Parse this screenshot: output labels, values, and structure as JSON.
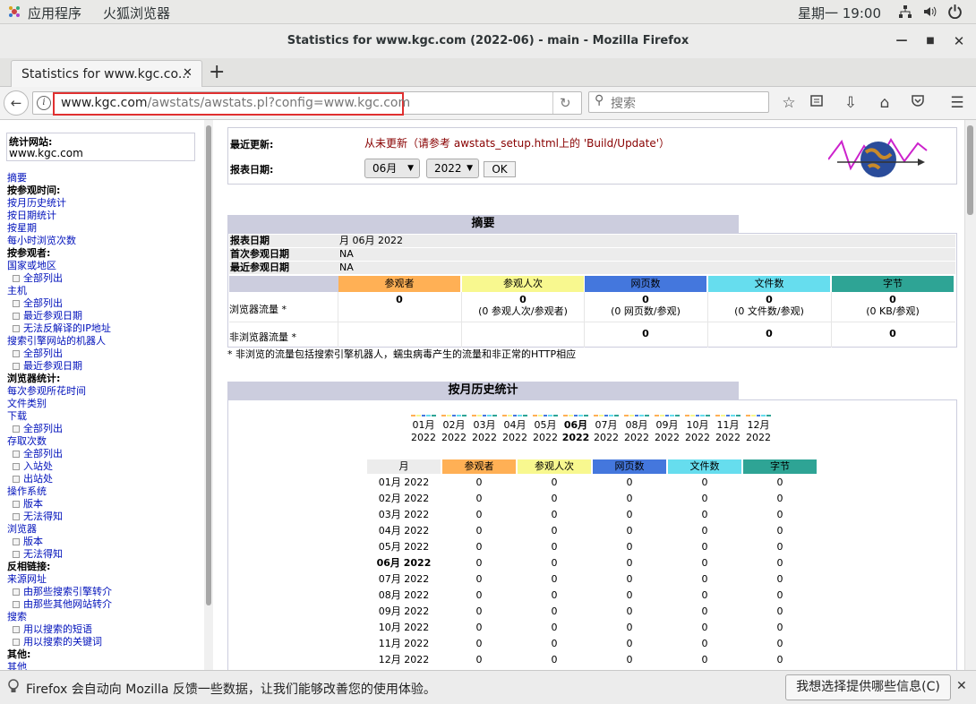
{
  "topbar": {
    "apps": "应用程序",
    "browser": "火狐浏览器",
    "clock": "星期一 19:00"
  },
  "window": {
    "title": "Statistics for www.kgc.com (2022-06) - main - Mozilla Firefox"
  },
  "tab": {
    "label": "Statistics for www.kgc.co..."
  },
  "nav": {
    "url_domain": "www.kgc.com",
    "url_path": "/awstats/awstats.pl?config=www.kgc.com",
    "search_placeholder": "搜索",
    "highlight_color": "#e03030"
  },
  "sidebar": {
    "site_label": "统计网站:",
    "site_value": "www.kgc.com",
    "items": [
      {
        "t": "摘要",
        "k": "link"
      },
      {
        "t": "按参观时间:",
        "k": "head"
      },
      {
        "t": "按月历史统计",
        "k": "link"
      },
      {
        "t": "按日期统计",
        "k": "link"
      },
      {
        "t": "按星期",
        "k": "link"
      },
      {
        "t": "每小时浏览次数",
        "k": "link"
      },
      {
        "t": "按参观者:",
        "k": "head"
      },
      {
        "t": "国家或地区",
        "k": "link"
      },
      {
        "t": "全部列出",
        "k": "sub"
      },
      {
        "t": "主机",
        "k": "link"
      },
      {
        "t": "全部列出",
        "k": "sub"
      },
      {
        "t": "最近参观日期",
        "k": "sub"
      },
      {
        "t": "无法反解译的IP地址",
        "k": "sub"
      },
      {
        "t": "搜索引擎网站的机器人",
        "k": "link"
      },
      {
        "t": "全部列出",
        "k": "sub"
      },
      {
        "t": "最近参观日期",
        "k": "sub"
      },
      {
        "t": "浏览器统计:",
        "k": "head"
      },
      {
        "t": "每次参观所花时间",
        "k": "link"
      },
      {
        "t": "文件类别",
        "k": "link"
      },
      {
        "t": "下载",
        "k": "link"
      },
      {
        "t": "全部列出",
        "k": "sub"
      },
      {
        "t": "存取次数",
        "k": "link"
      },
      {
        "t": "全部列出",
        "k": "sub"
      },
      {
        "t": "入站处",
        "k": "sub"
      },
      {
        "t": "出站处",
        "k": "sub"
      },
      {
        "t": "操作系统",
        "k": "link"
      },
      {
        "t": "版本",
        "k": "sub"
      },
      {
        "t": "无法得知",
        "k": "sub"
      },
      {
        "t": "浏览器",
        "k": "link"
      },
      {
        "t": "版本",
        "k": "sub"
      },
      {
        "t": "无法得知",
        "k": "sub"
      },
      {
        "t": "反相链接:",
        "k": "head"
      },
      {
        "t": "来源网址",
        "k": "link"
      },
      {
        "t": "由那些搜索引擎转介",
        "k": "sub"
      },
      {
        "t": "由那些其他网站转介",
        "k": "sub"
      },
      {
        "t": "搜索",
        "k": "link"
      },
      {
        "t": "用以搜索的短语",
        "k": "sub"
      },
      {
        "t": "用以搜索的关键词",
        "k": "sub"
      },
      {
        "t": "其他:",
        "k": "head"
      },
      {
        "t": "其他",
        "k": "link"
      }
    ]
  },
  "update_box": {
    "last_update_label": "最近更新:",
    "last_update_text": "从未更新（请参考",
    "last_update_link": "awstats_setup.html",
    "last_update_tail": "上的 'Build/Update'）",
    "report_date_label": "报表日期:",
    "month_value": "06月",
    "year_value": "2022",
    "ok_label": "OK"
  },
  "summary": {
    "title": "摘要",
    "rows": [
      {
        "label": "报表日期",
        "value": "月 06月 2022"
      },
      {
        "label": "首次参观日期",
        "value": "NA"
      },
      {
        "label": "最近参观日期",
        "value": "NA"
      }
    ],
    "headers": [
      "参观者",
      "参观人次",
      "网页数",
      "文件数",
      "字节"
    ],
    "header_colors": [
      "#ffb055",
      "#f8f88f",
      "#4477dd",
      "#66ddee",
      "#2ea495"
    ],
    "browser_label": "浏览器流量 *",
    "browser_values": [
      "0",
      "0",
      "0",
      "0",
      "0"
    ],
    "browser_subs": [
      "",
      "(0 参观人次/参观者)",
      "(0 网页数/参观)",
      "(0 文件数/参观)",
      "(0 KB/参观)"
    ],
    "nonbrowser_label": "非浏览器流量 *",
    "nonbrowser_values": [
      "",
      "",
      "0",
      "0",
      "0"
    ],
    "footnote": "* 非浏览的流量包括搜索引擎机器人，蠕虫病毒产生的流量和非正常的HTTP相应"
  },
  "monthly": {
    "title": "按月历史统计",
    "months": [
      "01月",
      "02月",
      "03月",
      "04月",
      "05月",
      "06月",
      "07月",
      "08月",
      "09月",
      "10月",
      "11月",
      "12月"
    ],
    "year": "2022",
    "current_index": 5,
    "table_headers": [
      "月",
      "参观者",
      "参观人次",
      "网页数",
      "文件数",
      "字节"
    ],
    "rows": [
      {
        "m": "01月 2022",
        "v": [
          "0",
          "0",
          "0",
          "0",
          "0"
        ]
      },
      {
        "m": "02月 2022",
        "v": [
          "0",
          "0",
          "0",
          "0",
          "0"
        ]
      },
      {
        "m": "03月 2022",
        "v": [
          "0",
          "0",
          "0",
          "0",
          "0"
        ]
      },
      {
        "m": "04月 2022",
        "v": [
          "0",
          "0",
          "0",
          "0",
          "0"
        ]
      },
      {
        "m": "05月 2022",
        "v": [
          "0",
          "0",
          "0",
          "0",
          "0"
        ]
      },
      {
        "m": "06月 2022",
        "v": [
          "0",
          "0",
          "0",
          "0",
          "0"
        ]
      },
      {
        "m": "07月 2022",
        "v": [
          "0",
          "0",
          "0",
          "0",
          "0"
        ]
      },
      {
        "m": "08月 2022",
        "v": [
          "0",
          "0",
          "0",
          "0",
          "0"
        ]
      },
      {
        "m": "09月 2022",
        "v": [
          "0",
          "0",
          "0",
          "0",
          "0"
        ]
      },
      {
        "m": "10月 2022",
        "v": [
          "0",
          "0",
          "0",
          "0",
          "0"
        ]
      },
      {
        "m": "11月 2022",
        "v": [
          "0",
          "0",
          "0",
          "0",
          "0"
        ]
      },
      {
        "m": "12月 2022",
        "v": [
          "0",
          "0",
          "0",
          "0",
          "0"
        ]
      }
    ]
  },
  "notification": {
    "text": "Firefox 会自动向 Mozilla 反馈一些数据，让我们能够改善您的使用体验。",
    "button": "我想选择提供哪些信息(C)"
  }
}
